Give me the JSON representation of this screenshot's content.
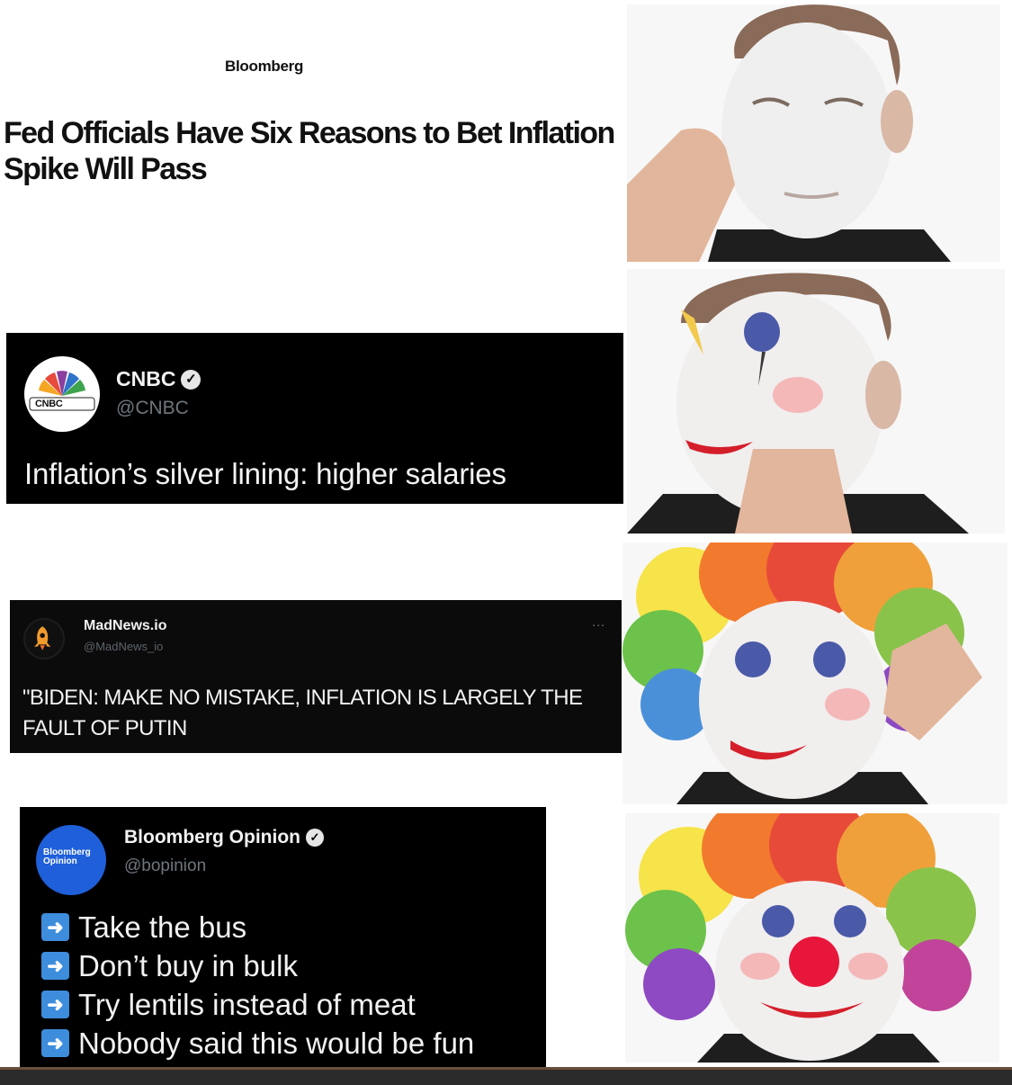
{
  "panel1": {
    "source": "Bloomberg",
    "headline": "Fed Officials Have Six Reasons to Bet Inflation Spike Will Pass"
  },
  "panel2": {
    "name": "CNBC",
    "handle": "@CNBC",
    "avatar_text": "CNBC",
    "text": "Inflation’s silver lining: higher salaries"
  },
  "panel3": {
    "name": "MadNews.io",
    "handle": "@MadNews_io",
    "more": "...",
    "text": "\"BIDEN: MAKE NO MISTAKE, INFLATION IS LARGELY THE FAULT OF PUTIN"
  },
  "panel4": {
    "name": "Bloomberg Opinion",
    "handle": "@bopinion",
    "avatar_text": "Bloomberg Opinion",
    "bullets": [
      "Take the bus",
      "Don’t buy in bulk",
      "Try lentils instead of meat",
      "Nobody said this would be fun"
    ]
  },
  "icons": {
    "verified": "verified-check-icon",
    "bullet": "right-arrow-icon"
  },
  "colors": {
    "tweet_background": "#000000",
    "tweet_text": "#f2f2f2",
    "handle_text": "#6e767d",
    "bullet_arrow": "#3d8ddc",
    "bloomberg_opinion_avatar": "#1f5fd9"
  }
}
